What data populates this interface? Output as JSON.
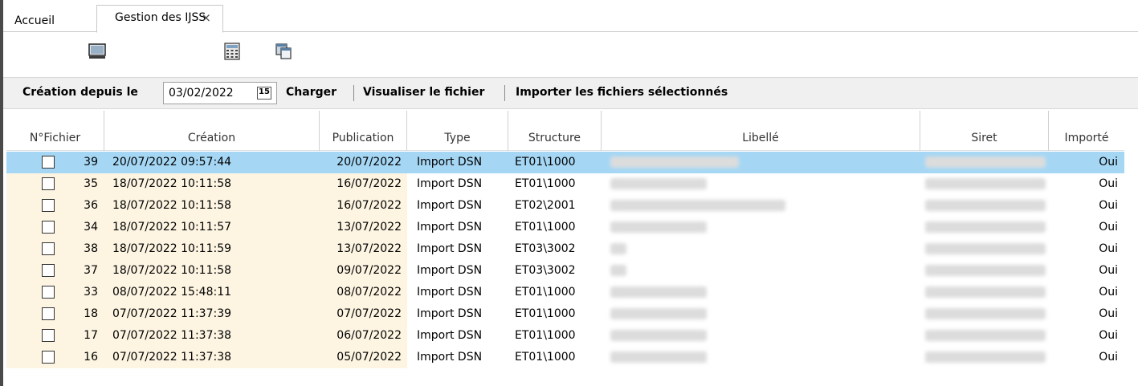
{
  "tabs": {
    "home_label": "Accueil",
    "active_label": "Gestion des IJSS",
    "close_glyph": "×"
  },
  "toolbar": {
    "icons": [
      "monitor-icon",
      "calculator-icon",
      "windows-icon"
    ]
  },
  "filter": {
    "label": "Création depuis le",
    "date_value": "03/02/2022",
    "calendar_glyph": "15",
    "load_label": "Charger",
    "view_file_label": "Visualiser le fichier",
    "import_selected_label": "Importer les fichiers sélectionnés"
  },
  "table": {
    "columns": [
      "N°Fichier",
      "Création",
      "Publication",
      "Type",
      "Structure",
      "Libellé",
      "Siret",
      "Importé"
    ],
    "rows": [
      {
        "id": "39",
        "creation": "20/07/2022 09:57:44",
        "publication": "20/07/2022",
        "type": "Import DSN",
        "structure": "ET01\\1000",
        "imported": "Oui",
        "selected": true
      },
      {
        "id": "35",
        "creation": "18/07/2022 10:11:58",
        "publication": "16/07/2022",
        "type": "Import DSN",
        "structure": "ET01\\1000",
        "imported": "Oui",
        "selected": false
      },
      {
        "id": "36",
        "creation": "18/07/2022 10:11:58",
        "publication": "16/07/2022",
        "type": "Import DSN",
        "structure": "ET02\\2001",
        "imported": "Oui",
        "selected": false
      },
      {
        "id": "34",
        "creation": "18/07/2022 10:11:57",
        "publication": "13/07/2022",
        "type": "Import DSN",
        "structure": "ET01\\1000",
        "imported": "Oui",
        "selected": false
      },
      {
        "id": "38",
        "creation": "18/07/2022 10:11:59",
        "publication": "13/07/2022",
        "type": "Import DSN",
        "structure": "ET03\\3002",
        "imported": "Oui",
        "selected": false
      },
      {
        "id": "37",
        "creation": "18/07/2022 10:11:58",
        "publication": "09/07/2022",
        "type": "Import DSN",
        "structure": "ET03\\3002",
        "imported": "Oui",
        "selected": false
      },
      {
        "id": "33",
        "creation": "08/07/2022 15:48:11",
        "publication": "08/07/2022",
        "type": "Import DSN",
        "structure": "ET01\\1000",
        "imported": "Oui",
        "selected": false
      },
      {
        "id": "18",
        "creation": "07/07/2022 11:37:39",
        "publication": "07/07/2022",
        "type": "Import DSN",
        "structure": "ET01\\1000",
        "imported": "Oui",
        "selected": false
      },
      {
        "id": "17",
        "creation": "07/07/2022 11:37:38",
        "publication": "06/07/2022",
        "type": "Import DSN",
        "structure": "ET01\\1000",
        "imported": "Oui",
        "selected": false
      },
      {
        "id": "16",
        "creation": "07/07/2022 11:37:38",
        "publication": "05/07/2022",
        "type": "Import DSN",
        "structure": "ET01\\1000",
        "imported": "Oui",
        "selected": false
      }
    ]
  },
  "colors": {
    "selected_row": "#a5d7f5",
    "tint_column": "#fdf5e2",
    "filter_bg": "#f0f0f0"
  }
}
